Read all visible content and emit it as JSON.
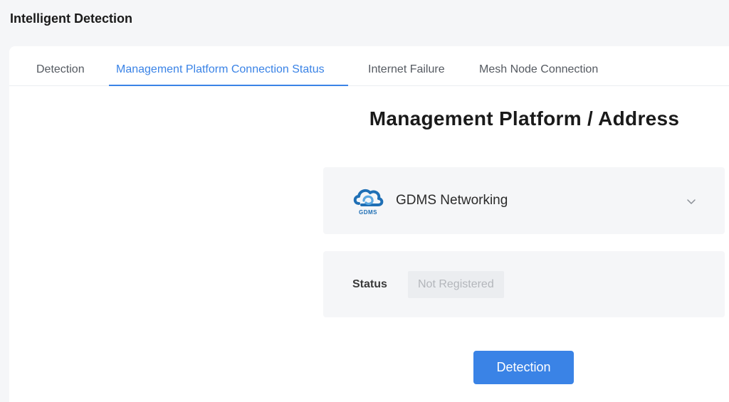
{
  "page": {
    "title": "Intelligent Detection"
  },
  "tabs": [
    {
      "label": "Detection",
      "active": false
    },
    {
      "label": "Management Platform Connection Status",
      "active": true
    },
    {
      "label": "Internet Failure",
      "active": false
    },
    {
      "label": "Mesh Node Connection",
      "active": false
    }
  ],
  "section": {
    "title": "Management Platform / Address"
  },
  "platform": {
    "name": "GDMS Networking",
    "logo_text": "GDMS",
    "icon": "gdms-cloud-logo"
  },
  "status": {
    "label": "Status",
    "value": "Not Registered"
  },
  "actions": {
    "detection_label": "Detection"
  },
  "colors": {
    "accent": "#3a83e6",
    "panel": "#f5f6f8",
    "logo": "#1f6fb5"
  }
}
